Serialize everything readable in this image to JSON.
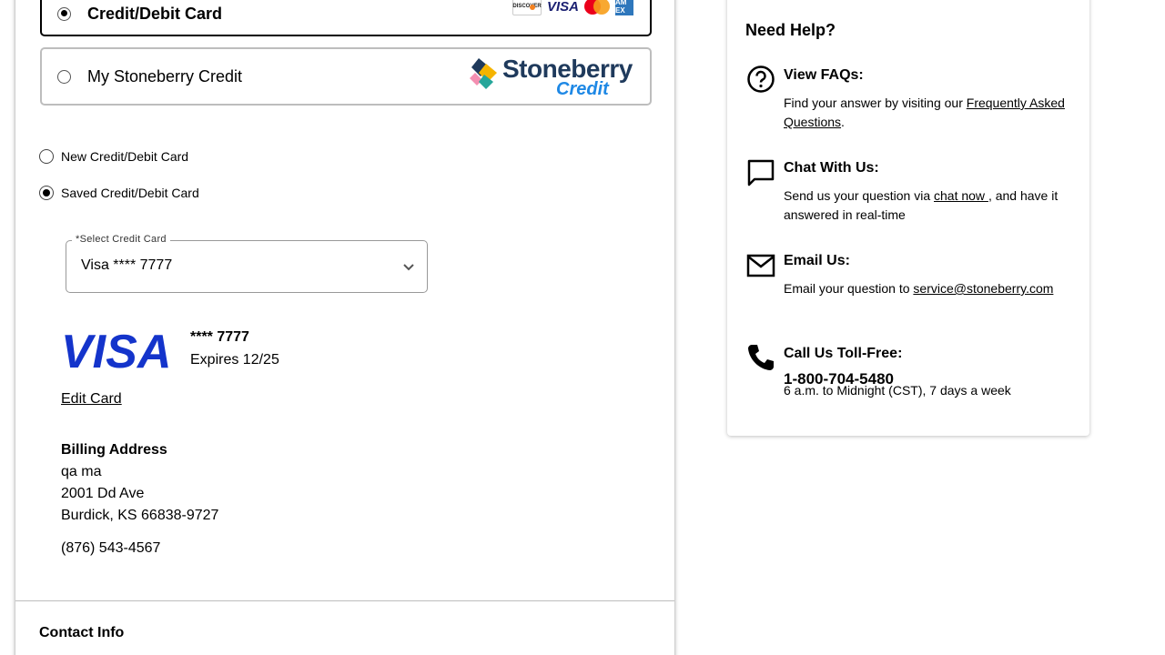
{
  "payment_options": {
    "credit_debit": {
      "label": "Credit/Debit Card",
      "selected": true
    },
    "stoneberry": {
      "label": "My Stoneberry Credit",
      "selected": false,
      "logo_name": "Stoneberry",
      "logo_sub": "Credit"
    }
  },
  "card_logos": {
    "discover": "DISCOVER",
    "visa": "VISA",
    "amex": "AM EX"
  },
  "card_choice": {
    "new_label": "New Credit/Debit Card",
    "saved_label": "Saved Credit/Debit Card",
    "selected": "saved"
  },
  "select_card": {
    "legend": "*Select Credit Card",
    "value": "Visa **** 7777"
  },
  "saved_card": {
    "brand": "VISA",
    "masked_number": "**** 7777",
    "expires": "Expires 12/25",
    "edit_label": "Edit Card"
  },
  "billing": {
    "title": "Billing Address",
    "name": "qa ma",
    "street": "2001 Dd Ave",
    "city_line": "Burdick, KS 66838-9727",
    "phone": "(876) 543-4567"
  },
  "contact": {
    "title": "Contact Info"
  },
  "help": {
    "title": "Need Help?",
    "faq": {
      "heading": "View FAQs:",
      "text_before": "Find your answer by visiting our ",
      "link": "Frequently Asked Questions",
      "text_after": "."
    },
    "chat": {
      "heading": "Chat With Us:",
      "text_before": "Send us your question via ",
      "link": "chat now ",
      "text_after": ", and have it answered in real-time"
    },
    "email": {
      "heading": "Email Us:",
      "text_before": "Email your question to ",
      "link": "service@stoneberry.com"
    },
    "phone": {
      "heading": "Call Us Toll-Free:",
      "number": "1-800-704-5480",
      "hours": "6 a.m. to Midnight (CST), 7 days a week"
    }
  },
  "colors": {
    "visa_blue": "#1434cb",
    "stoneberry_navy": "#1f3a5c",
    "stoneberry_blue": "#1e88e5"
  }
}
